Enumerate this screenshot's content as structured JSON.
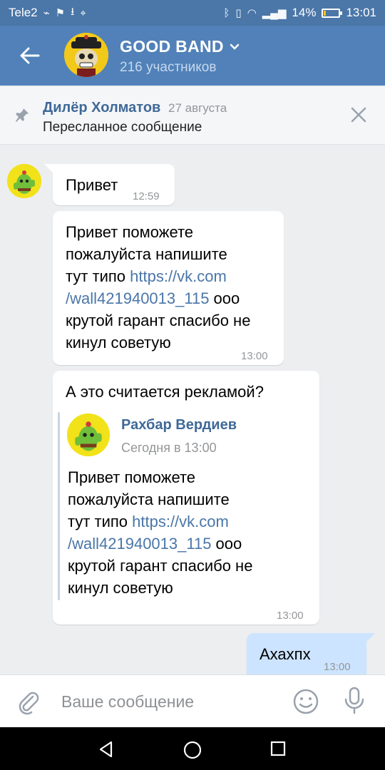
{
  "statusbar": {
    "carrier": "Tele2",
    "battery": "14%",
    "battery_level": 0.14,
    "time": "13:01"
  },
  "header": {
    "title": "GOOD BAND",
    "subtitle": "216 участников"
  },
  "pinned": {
    "author": "Дилёр Холматов",
    "date": "27 августа",
    "text": "Пересланное сообщение"
  },
  "messages": [
    {
      "text": "Привет",
      "time": "12:59"
    },
    {
      "text_before_link": "Привет поможете пожалуйста напишите тут типо",
      "link": "https://vk.com/wall421940013_115",
      "text_after_link": "ооо крутой гарант спасибо не кинул советую",
      "lines": [
        "Привет поможете",
        "пожалуйста напишите",
        "тут типо ",
        "https://vk.com",
        "/wall421940013_115",
        " ооо",
        "крутой гарант спасибо не",
        "кинул советую"
      ],
      "time": "13:00"
    },
    {
      "text": "А это считается рекламой?",
      "forwarded": {
        "author": "Рахбар Вердиев",
        "date": "Сегодня в 13:00",
        "lines": [
          "Привет поможете",
          "пожалуйста напишите",
          "тут типо ",
          "https://vk.com",
          "/wall421940013_115",
          " ооо",
          "крутой гарант спасибо не",
          "кинул советую"
        ]
      },
      "time": "13:00"
    },
    {
      "text": "Ахахпх",
      "time": "13:00",
      "outgoing": true
    }
  ],
  "input": {
    "placeholder": "Ваше сообщение"
  },
  "colors": {
    "header": "#5181b8",
    "statusbar": "#4a76a8",
    "link": "#4a76a8",
    "outgoing_bubble": "#cce4ff",
    "background": "#edeef0"
  },
  "icons": [
    "back-arrow-icon",
    "pin-icon",
    "close-icon",
    "attach-icon",
    "emoji-icon",
    "mic-icon",
    "nav-back-icon",
    "nav-home-icon",
    "nav-recent-icon"
  ]
}
